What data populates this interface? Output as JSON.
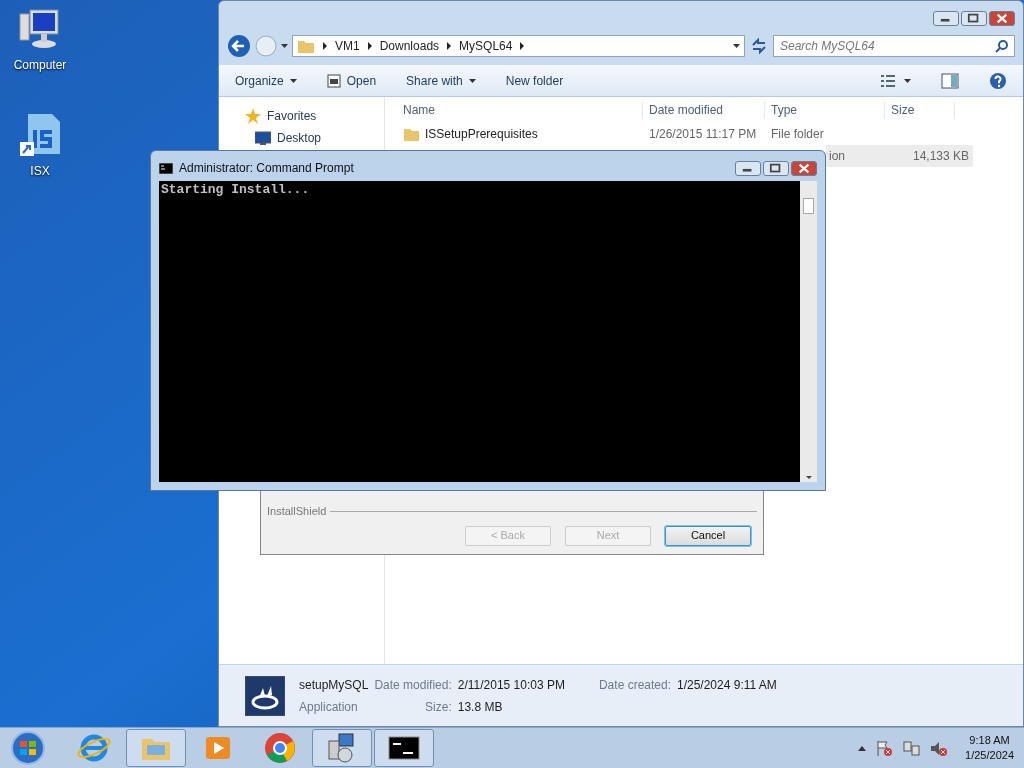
{
  "desktop_icons": [
    {
      "label": "Computer",
      "kind": "computer"
    },
    {
      "label": "ISX",
      "kind": "isx"
    }
  ],
  "explorer": {
    "breadcrumb": [
      "VM1",
      "Downloads",
      "MySQL64"
    ],
    "search": {
      "placeholder": "Search MySQL64"
    },
    "toolbar": [
      {
        "label": "Organize",
        "kind": "dropdown"
      },
      {
        "label": "Open",
        "kind": "icon"
      },
      {
        "label": "Share with",
        "kind": "dropdown"
      },
      {
        "label": "New folder",
        "kind": "plain"
      }
    ],
    "nav": [
      {
        "label": "Favorites",
        "kind": "star"
      },
      {
        "label": "Desktop",
        "kind": "desktop"
      }
    ],
    "columns": [
      "Name",
      "Date modified",
      "Type",
      "Size"
    ],
    "rows": [
      {
        "name": "ISSetupPrerequisites",
        "date": "1/26/2015 11:17 PM",
        "type": "File folder",
        "selected": false
      },
      {
        "type": "ion",
        "size": "14,133 KB",
        "selected": true
      }
    ],
    "details": {
      "name": "setupMySQL",
      "kind": "Application",
      "fields": [
        {
          "label": "Date modified:",
          "value": "2/11/2015 10:03 PM"
        },
        {
          "label": "Size:",
          "value": "13.8 MB"
        },
        {
          "label": "Date created:",
          "value": "1/25/2024 9:11 AM"
        }
      ]
    }
  },
  "cmd": {
    "title": "Administrator:  Command Prompt",
    "lines": [
      "Starting Install..."
    ]
  },
  "installshield": {
    "brand": "InstallShield",
    "buttons": [
      {
        "label": "< Back",
        "disabled": true,
        "default": false
      },
      {
        "label": "Next",
        "disabled": true,
        "default": false
      },
      {
        "label": "Cancel",
        "disabled": false,
        "default": true
      }
    ]
  },
  "taskbar": {
    "apps": [
      {
        "kind": "ie",
        "open": false
      },
      {
        "kind": "explorer",
        "open": true
      },
      {
        "kind": "media",
        "open": false
      },
      {
        "kind": "chrome",
        "open": false
      },
      {
        "kind": "installer",
        "open": true
      },
      {
        "kind": "cmd",
        "open": true
      }
    ],
    "time": "9:18 AM",
    "date": "1/25/2024"
  }
}
